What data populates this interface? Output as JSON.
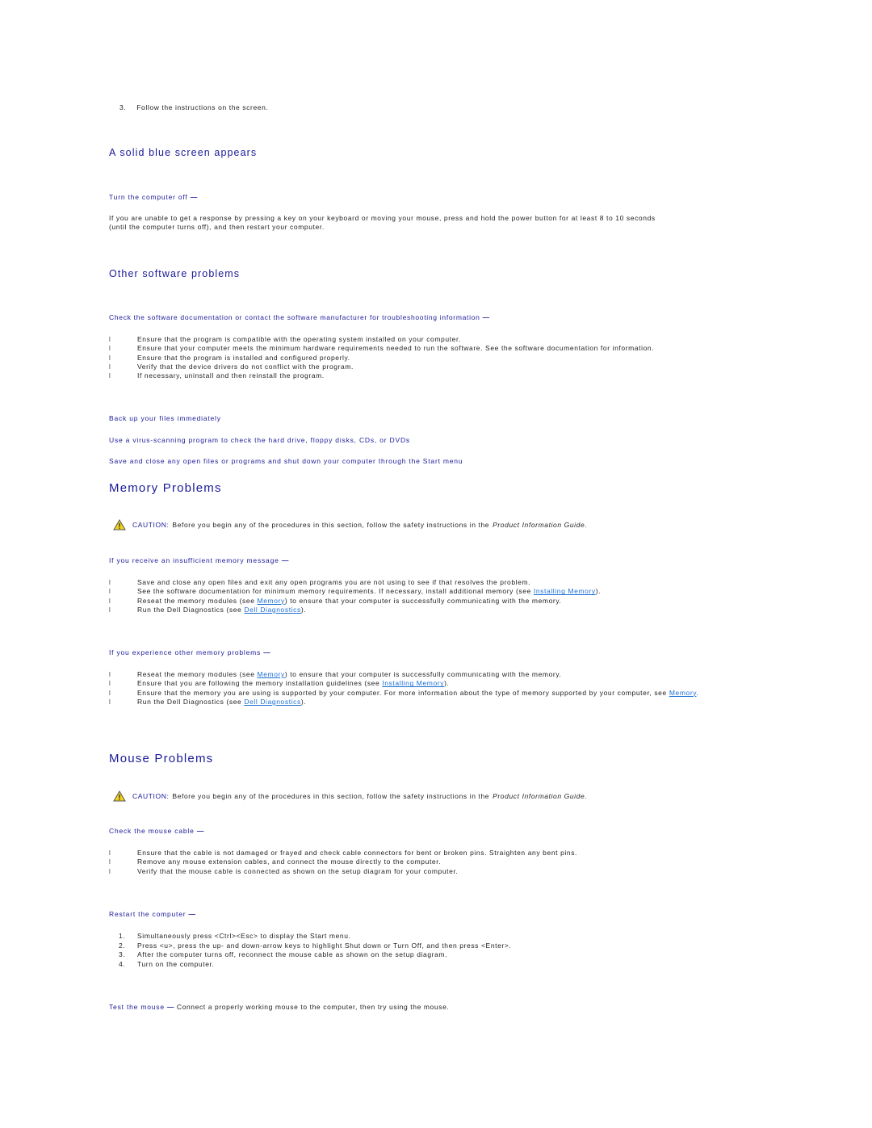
{
  "top_step": {
    "num": "3.",
    "text": "Follow the instructions on the screen."
  },
  "blue_screen": {
    "heading": "A solid blue screen appears",
    "sub": "Turn the computer off",
    "body_line1": "If you are unable to get a response by pressing a key on your keyboard or moving your mouse, press and hold the power button for at least 8 to 10 seconds",
    "body_line2": "(until the computer turns off), and then restart your computer."
  },
  "other_software": {
    "heading": "Other software problems",
    "sub": "Check the software documentation or contact the software manufacturer for troubleshooting information",
    "items": [
      "Ensure that the program is compatible with the operating system installed on your computer.",
      "Ensure that your computer meets the minimum hardware requirements needed to run the software. See the software documentation for information.",
      "Ensure that the program is installed and configured properly.",
      "Verify that the device drivers do not conflict with the program.",
      "If necessary, uninstall and then reinstall the program."
    ],
    "backup": "Back up your files immediately",
    "virus": "Use a virus-scanning program to check the hard drive, floppy disks, CDs, or DVDs",
    "save": "Save and close any open files or programs and shut down your computer through the Start menu"
  },
  "bullet_glyph": "l",
  "dash": "—",
  "caution": {
    "label": "CAUTION:",
    "text": "Before you begin any of the procedures in this section, follow the safety instructions in the",
    "guide": "Product Information Guide",
    "end": "."
  },
  "memory": {
    "heading": "Memory Problems",
    "sub1": "If you receive an insufficient memory message",
    "list1": [
      {
        "pre": "Save and close any open files and exit any open programs you are not using to see if that resolves the problem.",
        "link": "",
        "post": ""
      },
      {
        "pre": "See the software documentation for minimum memory requirements. If necessary, install additional memory (see ",
        "link": "Installing Memory",
        "post": ")."
      },
      {
        "pre": "Reseat the memory modules (see ",
        "link": "Memory",
        "post": ") to ensure that your computer is successfully communicating with the memory."
      },
      {
        "pre": "Run the Dell Diagnostics (see ",
        "link": "Dell Diagnostics",
        "post": ")."
      }
    ],
    "sub2": "If you experience other memory problems",
    "list2": [
      {
        "pre": "Reseat the memory modules (see ",
        "link": "Memory",
        "post": ") to ensure that your computer is successfully communicating with the memory."
      },
      {
        "pre": "Ensure that you are following the memory installation guidelines (see ",
        "link": "Installing Memory",
        "post": ")."
      },
      {
        "pre": "Ensure that the memory you are using is supported by your computer. For more information about the type of memory supported by your computer, see ",
        "link": "Memory",
        "post": "."
      },
      {
        "pre": "Run the Dell Diagnostics (see ",
        "link": "Dell Diagnostics",
        "post": ")."
      }
    ]
  },
  "mouse": {
    "heading": "Mouse Problems",
    "sub1": "Check the mouse cable",
    "list1": [
      "Ensure that the cable is not damaged or frayed and check cable connectors for bent or broken pins. Straighten any bent pins.",
      "Remove any mouse extension cables, and connect the mouse directly to the computer.",
      "Verify that the mouse cable is connected as shown on the setup diagram for your computer."
    ],
    "sub2": "Restart the computer",
    "steps": [
      {
        "num": "1.",
        "text": "Simultaneously press <Ctrl><Esc> to display the Start menu."
      },
      {
        "num": "2.",
        "text": "Press <u>, press the up- and down-arrow keys to highlight Shut down or Turn Off, and then press <Enter>."
      },
      {
        "num": "3.",
        "text": "After the computer turns off, reconnect the mouse cable as shown on the setup diagram."
      },
      {
        "num": "4.",
        "text": "Turn on the computer."
      }
    ],
    "test_label": "Test the mouse",
    "test_text": "Connect a properly working mouse to the computer, then try using the mouse."
  },
  "colors": {
    "heading": "#1a1a99",
    "link": "#1a6fd6",
    "caution_fill": "#f2d21a"
  }
}
